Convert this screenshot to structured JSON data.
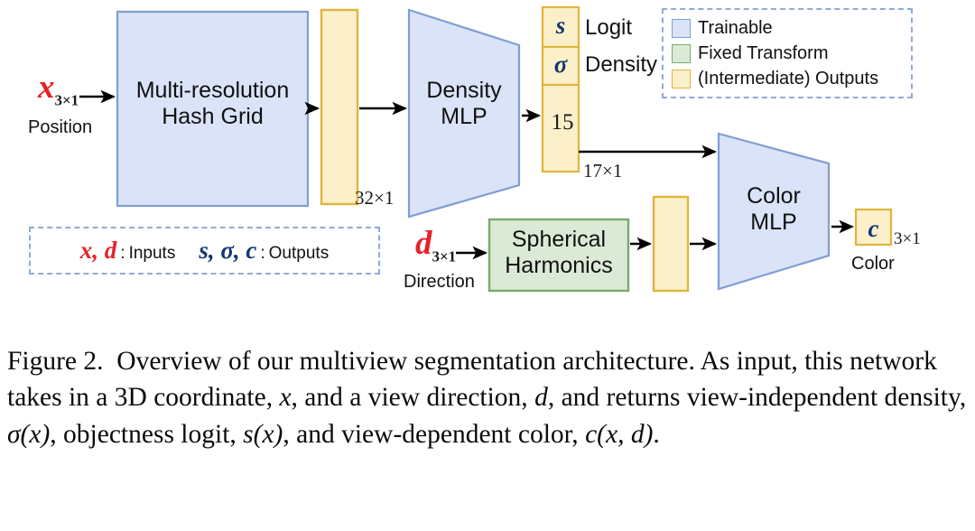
{
  "figure": {
    "domain_type": "diagram",
    "caption_label": "Figure 2.",
    "caption_text": "Overview of our multiview segmentation architecture. As input, this network takes in a 3D coordinate, x, and a view direction, d, and returns view-independent density, σ(x), objectness logit, s(x), and view-dependent color, c(x, d)."
  },
  "colors": {
    "trainable_fill": "#dae3f8",
    "trainable_stroke": "#7f9ed3",
    "fixed_fill": "#dbead7",
    "fixed_stroke": "#77ab6b",
    "output_fill": "#fcf0cb",
    "output_stroke": "#e0b53c",
    "legend_border": "#8faadc",
    "input_var": "#e8202a",
    "output_var": "#12386e",
    "arrow": "#000000"
  },
  "inputs": {
    "position": {
      "symbol": "x",
      "dim": "3×1",
      "caption": "Position"
    },
    "direction": {
      "symbol": "d",
      "dim": "3×1",
      "caption": "Direction"
    }
  },
  "blocks": {
    "hash_grid": {
      "line1": "Multi-resolution",
      "line2": "Hash Grid",
      "kind": "trainable"
    },
    "density_mlp": {
      "line1": "Density",
      "line2": "MLP",
      "kind": "trainable"
    },
    "spherical_harmonics": {
      "line1": "Spherical",
      "line2": "Harmonics",
      "kind": "fixed"
    },
    "color_mlp": {
      "line1": "Color",
      "line2": "MLP",
      "kind": "trainable"
    }
  },
  "intermediates": {
    "hash_feature": {
      "dim": "32×1"
    },
    "density_output": {
      "cells": [
        {
          "symbol": "s",
          "label": "Logit"
        },
        {
          "symbol": "σ",
          "label": "Density"
        },
        {
          "symbol": "15",
          "label": ""
        }
      ],
      "dim": "17×1"
    },
    "sh_feature": {
      "dim": ""
    }
  },
  "outputs": {
    "color": {
      "symbol": "c",
      "dim": "3×1",
      "caption": "Color"
    }
  },
  "legend": {
    "items": [
      {
        "label": "Trainable",
        "fill": "#dae3f8",
        "stroke": "#7f9ed3"
      },
      {
        "label": "Fixed Transform",
        "fill": "#dbead7",
        "stroke": "#77ab6b"
      },
      {
        "label": "(Intermediate) Outputs",
        "fill": "#fcf0cb",
        "stroke": "#e0b53c"
      }
    ]
  },
  "io_legend": {
    "inputs": {
      "vars": "x, d",
      "sep": ":",
      "word": "Inputs"
    },
    "outputs": {
      "vars": "s, σ, c",
      "sep": ":",
      "word": "Outputs"
    }
  }
}
